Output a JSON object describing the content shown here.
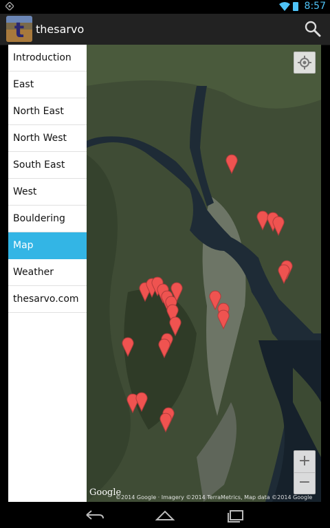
{
  "status": {
    "time": "8:57"
  },
  "app": {
    "title": "thesarvo",
    "icon_letter": "t"
  },
  "nav": {
    "items": [
      {
        "label": "Introduction"
      },
      {
        "label": "East"
      },
      {
        "label": "North East"
      },
      {
        "label": "North West"
      },
      {
        "label": "South East"
      },
      {
        "label": "West"
      },
      {
        "label": "Bouldering"
      },
      {
        "label": "Map",
        "active": true
      },
      {
        "label": "Weather"
      },
      {
        "label": "thesarvo.com"
      }
    ]
  },
  "map": {
    "logo": "Google",
    "attribution": "©2014 Google · Imagery ©2014 TerraMetrics, Map data ©2014 Google",
    "marker_color": "#ef5350",
    "zoom_in": "+",
    "zoom_out": "−"
  },
  "colors": {
    "accent": "#33b5e5",
    "action_bar": "#222222"
  }
}
